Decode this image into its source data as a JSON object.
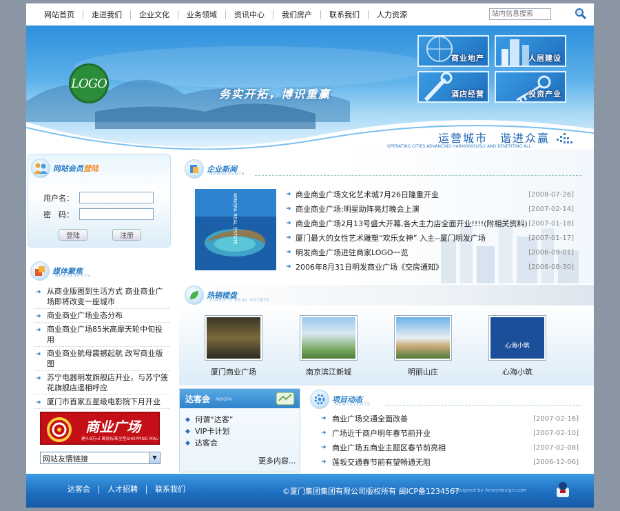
{
  "nav": {
    "items": [
      "网站首页",
      "走进我们",
      "企业文化",
      "业务领域",
      "资讯中心",
      "我们房产",
      "联系我们",
      "人力资源"
    ],
    "search_placeholder": "站内信息搜索"
  },
  "banner": {
    "logo_text": "LOGO",
    "slogan": "务实开拓，博识重赢",
    "tiles": [
      "商业地产",
      "人居建设",
      "酒店经营",
      "投资产业"
    ],
    "motto": "运营城市　谐进众赢",
    "motto_en": "OPERATING CITIES ADVANCING HARMONIOUSLY AND BENEFITING ALL"
  },
  "member": {
    "title_prefix": "网站会员",
    "title_highlight": "登陆",
    "username_label": "用户名：",
    "password_label": "密　码：",
    "login_button": "登陆",
    "register_button": "注册"
  },
  "media": {
    "title": "媒体聚焦",
    "subtitle": "NEWSEVENTS",
    "items": [
      "从商业版图到生活方式 商业商业广场即将改变一座城市",
      "商业商业广场业态分布",
      "商业商业广场85米高摩天轮中旬投用",
      "商业商业航母震撼起航 改写商业版图",
      "苏宁电器明发旗舰店开业，与苏宁莲花旗舰店遥相呼应",
      "厦门市首家五星级电影院下月开业"
    ]
  },
  "ad": {
    "text": "商业广场",
    "sub": "建4.8万㎡ 国际标准全型SHOPPING MALL"
  },
  "friend_links": {
    "selected": "网站友情链接"
  },
  "news": {
    "title": "企业新闻",
    "subtitle": "NEWSEVENTS",
    "image_text": "MINGFA REAL ESTATE",
    "items": [
      {
        "title": "商业商业广场文化艺术城7月26日隆重开业",
        "date": "[2008-07-26]"
      },
      {
        "title": "商业商业广场:明星助阵亮灯晚会上演",
        "date": "[2007-02-14]"
      },
      {
        "title": "商业商业广场2月13号盛大开幕,各大主力店全面开业!!!!(附相关资料)",
        "date": "[2007-01-18]"
      },
      {
        "title": "厦门最大的女性艺术雕塑“欢乐女神” 入主--厦门明发广场",
        "date": "[2007-01-17]"
      },
      {
        "title": "明发商业广场进驻商家LOGO一览",
        "date": "[2006-09-01]"
      },
      {
        "title": "2006年8月31日明发商业广场《交房通知》",
        "date": "[2006-08-30]"
      }
    ]
  },
  "hot": {
    "title": "热销楼盘",
    "subtitle": "XIANGYU REAL ESTATE",
    "items": [
      "厦门商业广场",
      "南京滨江新城",
      "明丽山庄",
      "心海小筑"
    ],
    "logo4_text": "心海小筑"
  },
  "club": {
    "title": "达客会",
    "subtitle": "MINGFA",
    "items": [
      "何谓“达客”",
      "VIP卡计划",
      "达客会"
    ],
    "more": "更多内容..."
  },
  "projects": {
    "title": "项目动态",
    "subtitle": "NEWSEVENTS",
    "items": [
      {
        "title": "商业广场交通全面改善",
        "date": "[2007-02-16]"
      },
      {
        "title": "广场近千商户明年春节前开业",
        "date": "[2007-02-10]"
      },
      {
        "title": "商业广场五商业主题区春节前亮相",
        "date": "[2007-02-08]"
      },
      {
        "title": "莲坂交通春节前有望畅通无阻",
        "date": "[2006-12-06]"
      }
    ]
  },
  "footer": {
    "links": [
      "达客会",
      "人才招聘",
      "联系我们"
    ],
    "copyright": "©厦门集团集团有限公司版权所有 闽ICP备1234567",
    "designed": "Designed by Amoydesign.com"
  },
  "colors": {
    "accent": "#2d7ec8",
    "highlight": "#f28a1a",
    "footer": "#1f6fc0",
    "page_bg": "#8a96a3"
  }
}
